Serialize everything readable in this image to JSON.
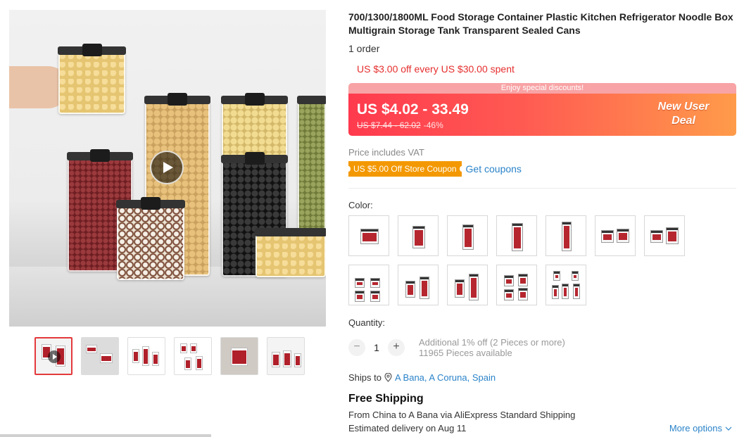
{
  "product": {
    "title": "700/1300/1800ML Food Storage Container Plastic Kitchen Refrigerator Noodle Box Multigrain Storage Tank Transparent Sealed Cans",
    "orders": "1 order",
    "promo_line": "US $3.00 off every US $30.00 spent"
  },
  "deal": {
    "banner_text": "Enjoy special discounts!",
    "price_range": "US $4.02 - 33.49",
    "original_price": "US $7.44 - 62.02",
    "discount": "-46%",
    "tag_line1": "New User",
    "tag_line2": "Deal",
    "colors": {
      "start": "#ff3a4e",
      "end": "#ff9b4a"
    }
  },
  "vat_note": "Price includes VAT",
  "coupon": {
    "badge": "US $5.00 Off Store Coupon",
    "link": "Get coupons"
  },
  "color_label": "Color:",
  "quantity": {
    "label": "Quantity:",
    "value": "1",
    "minus": "−",
    "plus": "+",
    "note_line1": "Additional 1% off (2 Pieces or more)",
    "note_line2": "11965 Pieces available"
  },
  "shipping": {
    "ships_to_label": "Ships to",
    "location": "A Bana, A Coruna, Spain",
    "free_shipping": "Free Shipping",
    "from_text": "From China to A Bana via AliExpress Standard Shipping",
    "eta": "Estimated delivery on Aug 11",
    "more_options": "More options"
  },
  "icons": {
    "play": "play-icon",
    "location": "location-pin-icon",
    "chevron": "chevron-down-icon"
  },
  "accent_color": "#e62e2e",
  "link_color": "#2a83c9"
}
